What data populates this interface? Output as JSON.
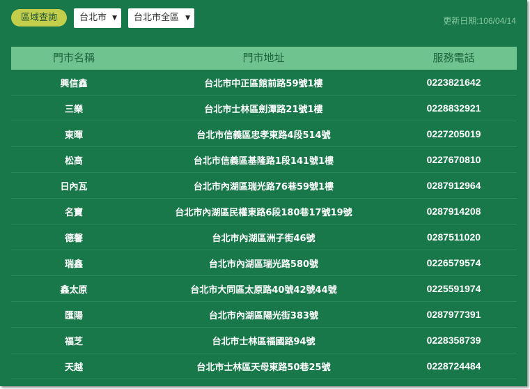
{
  "toolbar": {
    "query_label": "區域查詢",
    "city_value": "台北市",
    "district_value": "台北市全區",
    "caret": "▼",
    "update_date": "更新日期:106/04/14"
  },
  "table": {
    "headers": [
      "門市名稱",
      "門市地址",
      "服務電話"
    ],
    "rows": [
      {
        "name": "興信鑫",
        "address": "台北市中正區館前路59號1樓",
        "phone": "0223821642"
      },
      {
        "name": "三樂",
        "address": "台北市士林區劍潭路21號1樓",
        "phone": "0228832921"
      },
      {
        "name": "東暉",
        "address": "台北市信義區忠孝東路4段514號",
        "phone": "0227205019"
      },
      {
        "name": "松高",
        "address": "台北市信義區基隆路1段141號1樓",
        "phone": "0227670810"
      },
      {
        "name": "日內瓦",
        "address": "台北市內湖區瑞光路76巷59號1樓",
        "phone": "0287912964"
      },
      {
        "name": "名寶",
        "address": "台北市內湖區民權東路6段180巷17號19號",
        "phone": "0287914208"
      },
      {
        "name": "德馨",
        "address": "台北市內湖區洲子街46號",
        "phone": "0287511020"
      },
      {
        "name": "瑞鑫",
        "address": "台北市內湖區瑞光路580號",
        "phone": "0226579574"
      },
      {
        "name": "鑫太原",
        "address": "台北市大同區太原路40號42號44號",
        "phone": "0225591974"
      },
      {
        "name": "匯陽",
        "address": "台北市內湖區陽光街383號",
        "phone": "0287977391"
      },
      {
        "name": "福芝",
        "address": "台北市士林區福國路94號",
        "phone": "0228358739"
      },
      {
        "name": "天越",
        "address": "台北市士林區天母東路50巷25號",
        "phone": "0228724484"
      }
    ]
  },
  "colors": {
    "background": "#18784a",
    "header": "#6fc38f",
    "button": "#c3cf4a"
  }
}
